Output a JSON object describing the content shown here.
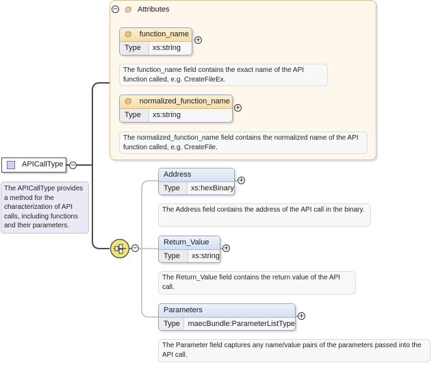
{
  "root": {
    "name": "APICallType",
    "description": "The APICallType provides a method for the characterization of API calls, including functions and their parameters."
  },
  "attributes_group": {
    "title": "Attributes",
    "items": [
      {
        "name": "function_name",
        "type_key": "Type",
        "type_value": "xs:string",
        "description": "The function_name field contains the exact name of the API function called, e.g. CreateFileEx."
      },
      {
        "name": "normalized_function_name",
        "type_key": "Type",
        "type_value": "xs:string",
        "description": "The normalized_function_name field contains the normalized name of the API function called, e.g. CreateFile."
      }
    ]
  },
  "sequence": {
    "elements": [
      {
        "name": "Address",
        "type_key": "Type",
        "type_value": "xs:hexBinary",
        "description": "The Address field contains the address of the API call in the binary."
      },
      {
        "name": "Return_Value",
        "type_key": "Type",
        "type_value": "xs:string",
        "description": "The Return_Value field contains the return value of the API call."
      },
      {
        "name": "Parameters",
        "type_key": "Type",
        "type_value": "maecBundle:ParameterListType",
        "description": "The Parameter field captures any name/value pairs of the parameters passed into the API call."
      }
    ]
  },
  "symbols": {
    "expand": "+",
    "collapse": "−",
    "attribute_marker": "@"
  },
  "colors": {
    "attribute_header": "#f6ddaa",
    "element_header": "#d3e0f3",
    "connector": "#4a4a4a",
    "compositor_fill": "#f3e47a"
  }
}
